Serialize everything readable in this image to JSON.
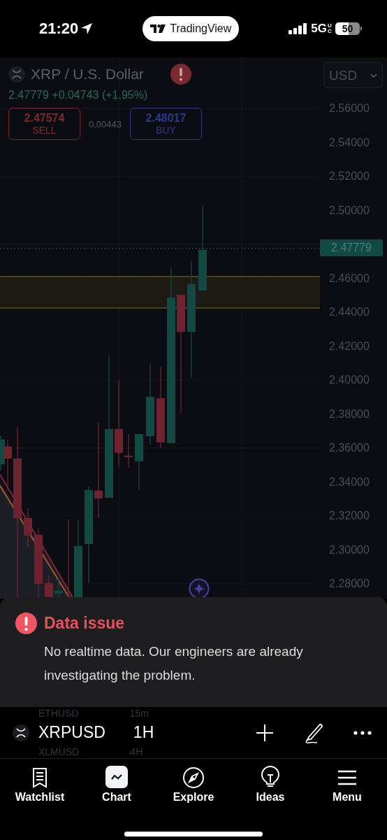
{
  "status_bar": {
    "time": "21:20",
    "app_pill": "TradingView",
    "network": "5G",
    "network_sub": "UC",
    "battery": "50"
  },
  "chart": {
    "symbol_title": "XRP / U.S. Dollar",
    "quote": "2.47779 +0.04743 (+1.95%)",
    "sell": {
      "price": "2.47574",
      "label": "SELL"
    },
    "spread": "0.00443",
    "buy": {
      "price": "2.48017",
      "label": "BUY"
    },
    "currency": "USD",
    "price_axis": [
      "2.56000",
      "2.54000",
      "2.52000",
      "2.50000",
      "2.46000",
      "2.44000",
      "2.42000",
      "2.40000",
      "2.38000",
      "2.36000",
      "2.34000",
      "2.32000",
      "2.30000",
      "2.28000"
    ],
    "last_price": "2.47779"
  },
  "alert": {
    "title": "Data issue",
    "message": "No realtime data. Our engineers are already investigating the problem."
  },
  "toolbar": {
    "symbol": "XRPUSD",
    "interval": "1H",
    "above": {
      "symbol": "ETHUSD",
      "interval": "15m"
    },
    "below": {
      "symbol": "XLMUSD",
      "interval": "4H"
    }
  },
  "tabs": [
    {
      "label": "Watchlist",
      "kind": "watchlist",
      "selected": false
    },
    {
      "label": "Chart",
      "kind": "chart",
      "selected": true
    },
    {
      "label": "Explore",
      "kind": "explore",
      "selected": false
    },
    {
      "label": "Ideas",
      "kind": "ideas",
      "selected": false
    },
    {
      "label": "Menu",
      "kind": "menu",
      "selected": false
    }
  ]
}
